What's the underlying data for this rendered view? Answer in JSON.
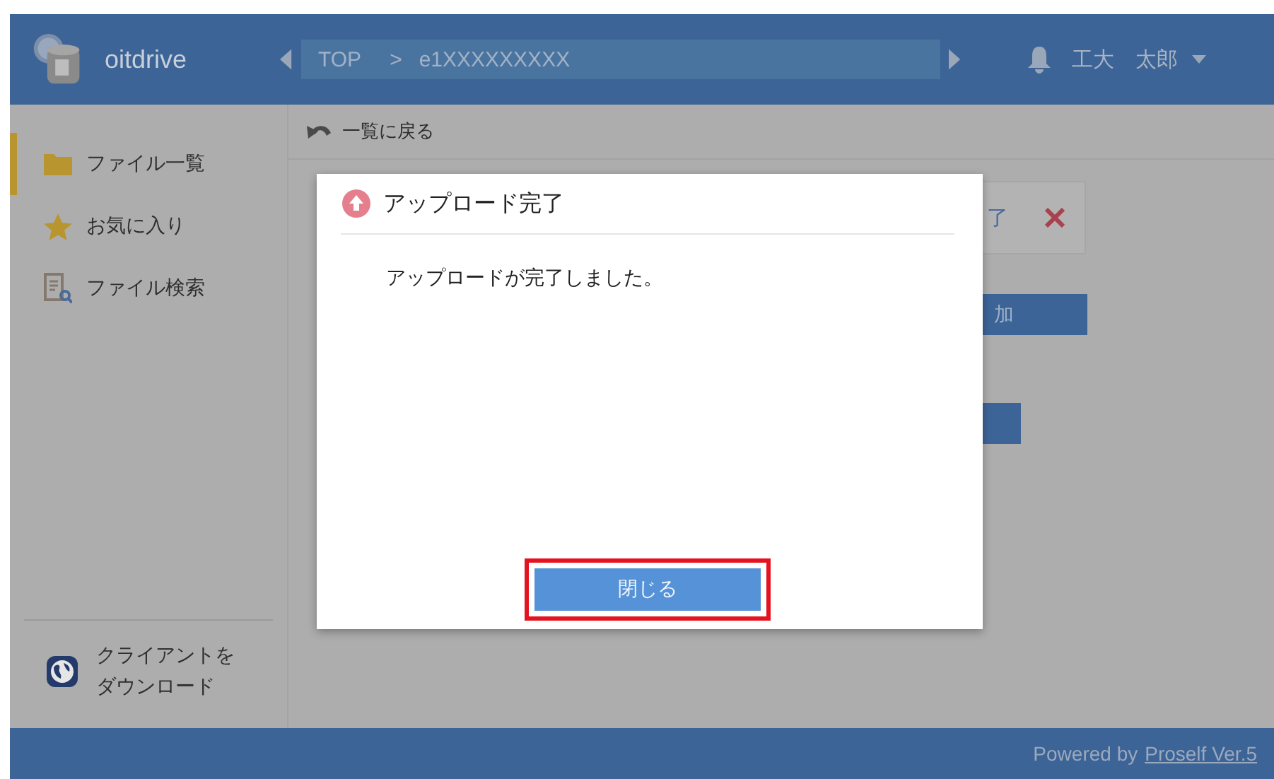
{
  "header": {
    "app_name": "oitdrive",
    "breadcrumb": [
      {
        "label": "TOP"
      },
      {
        "label": "e1XXXXXXXXX"
      }
    ],
    "separator": ">",
    "user_name": "工大　太郎"
  },
  "sidebar": {
    "items": [
      {
        "label": "ファイル一覧",
        "kind": "folder",
        "selected": true
      },
      {
        "label": "お気に入り",
        "kind": "star",
        "selected": false
      },
      {
        "label": "ファイル検索",
        "kind": "search",
        "selected": false
      }
    ],
    "download_link": "クライアントをダウンロード"
  },
  "toolbar": {
    "back_label": "一覧に戻る"
  },
  "background": {
    "card_text": "了",
    "add_button": "加"
  },
  "dialog": {
    "title": "アップロード完了",
    "message": "アップロードが完了しました。",
    "close_button": "閉じる",
    "close_highlighted": true
  },
  "footer": {
    "prefix": "Powered by",
    "link": "Proself Ver.5"
  }
}
